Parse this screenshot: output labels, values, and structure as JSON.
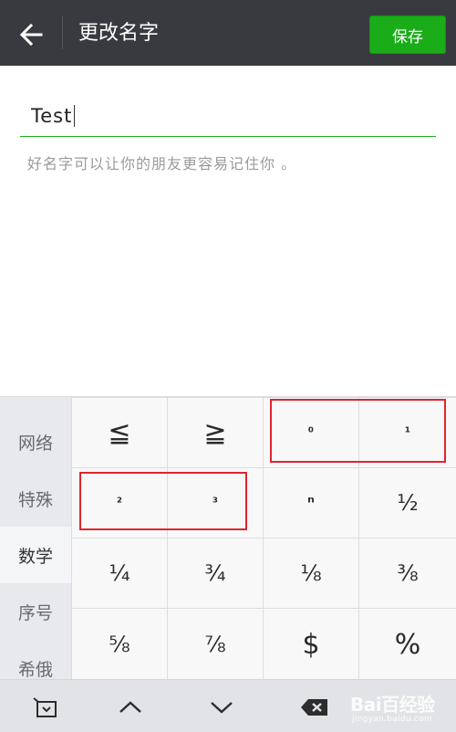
{
  "header": {
    "title": "更改名字",
    "save_label": "保存",
    "back_icon": "arrow-left-icon",
    "bg_color": "#393a3f"
  },
  "name_field": {
    "value": "Test",
    "hint": "好名字可以让你的朋友更容易记住你 。",
    "underline_color": "#1aad19"
  },
  "keyboard": {
    "categories": [
      {
        "label": "网络",
        "active": false
      },
      {
        "label": "特殊",
        "active": false
      },
      {
        "label": "数学",
        "active": true
      },
      {
        "label": "序号",
        "active": false
      },
      {
        "label": "希俄",
        "active": false
      }
    ],
    "keys": [
      "≦",
      "≧",
      "⁰",
      "¹",
      "²",
      "³",
      "ⁿ",
      "½",
      "¼",
      "¾",
      "⅛",
      "⅜",
      "⅝",
      "⅞",
      "$",
      "%"
    ],
    "toolbar": {
      "icons": [
        "keyboard-collapse-icon",
        "chevron-up-icon",
        "chevron-down-icon",
        "backspace-icon"
      ]
    }
  },
  "watermark": {
    "main": "Bai百经验",
    "sub": "jingyan.baidu.com"
  },
  "colors": {
    "accent": "#1aad19",
    "highlight": "#e0242c"
  }
}
